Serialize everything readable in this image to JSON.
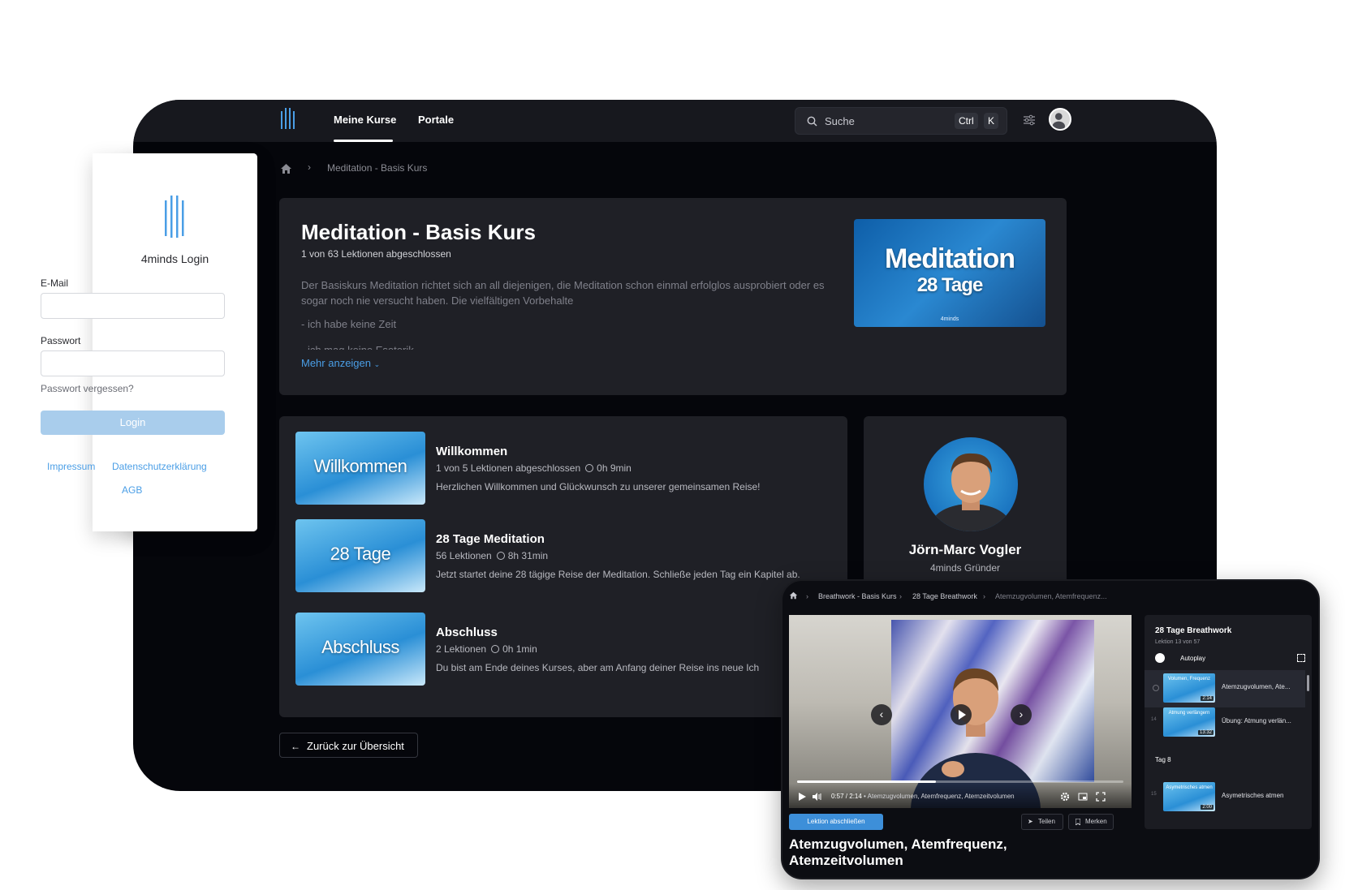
{
  "app": {
    "nav": {
      "my_courses": "Meine Kurse",
      "portals": "Portale"
    },
    "search": {
      "placeholder": "Suche",
      "key1": "Ctrl",
      "key2": "K"
    },
    "breadcrumb": {
      "course": "Meditation - Basis Kurs"
    },
    "course": {
      "title": "Meditation - Basis Kurs",
      "progress": "1 von 63 Lektionen abgeschlossen",
      "description": "Der Basiskurs Meditation richtet sich an all diejenigen, die Meditation schon einmal erfolglos ausprobiert oder es sogar noch nie versucht haben. Die vielfältigen Vorbehalte",
      "bullet1": "- ich habe keine Zeit",
      "bullet2": "- ich mag keine Esoterik",
      "more_label": "Mehr anzeigen",
      "thumb_title": "Meditation",
      "thumb_sub": "28 Tage",
      "thumb_brand": "4minds"
    },
    "lessons": [
      {
        "thumb": "Willkommen",
        "title": "Willkommen",
        "meta": "1 von 5 Lektionen abgeschlossen",
        "duration": "0h 9min",
        "desc": "Herzlichen Willkommen und Glückwunsch zu unserer gemeinsamen Reise!"
      },
      {
        "thumb": "28 Tage",
        "title": "28 Tage Meditation",
        "meta": "56 Lektionen",
        "duration": "8h 31min",
        "desc": "Jetzt startet deine 28 tägige Reise der Meditation. Schließe jeden Tag ein Kapitel ab."
      },
      {
        "thumb": "Abschluss",
        "title": "Abschluss",
        "meta": "2 Lektionen",
        "duration": "0h 1min",
        "desc": "Du bist am Ende deines Kurses, aber am Anfang deiner Reise ins neue Ich"
      }
    ],
    "teacher": {
      "name": "Jörn-Marc Vogler",
      "role": "4minds Gründer"
    },
    "back_label": "Zurück zur Übersicht"
  },
  "login": {
    "title": "4minds Login",
    "email_label": "E-Mail",
    "password_label": "Passwort",
    "forgot": "Passwort vergessen?",
    "button": "Login",
    "links": {
      "impressum": "Impressum",
      "privacy": "Datenschutzerklärung",
      "agb": "AGB"
    }
  },
  "player": {
    "breadcrumb": {
      "course": "Breathwork - Basis Kurs",
      "chapter": "28 Tage Breathwork",
      "lesson": "Atemzugvolumen, Atemfrequenz..."
    },
    "time": "0:57 / 2:14",
    "chapter_label": "• Atemzugvolumen, Atemfrequenz, Atemzeitvolumen",
    "progress_fraction": 0.425,
    "complete_button": "Lektion abschließen",
    "share": "Teilen",
    "save": "Merken",
    "lesson_title": "Atemzugvolumen, Atemfrequenz, Atemzeitvolumen",
    "playlist": {
      "title": "28 Tage Breathwork",
      "sub": "Lektion 13 von 57",
      "autoplay": "Autoplay",
      "day": "Tag 8",
      "items": [
        {
          "num": "",
          "thumb": "Volumen, Frequenz",
          "dur": "2:14",
          "label": "Atemzugvolumen, Ate..."
        },
        {
          "num": "14",
          "thumb": "Atmung verlängern",
          "dur": "13:32",
          "label": "Übung: Atmung verlän..."
        },
        {
          "num": "15",
          "thumb": "Asymetrisches atmen",
          "dur": "2:00",
          "label": "Asymetrisches atmen"
        }
      ]
    }
  },
  "colors": {
    "accent": "#4a9ee6",
    "bg_dark": "#05060b",
    "card": "#1f2026",
    "login_button": "#a9cdec"
  }
}
